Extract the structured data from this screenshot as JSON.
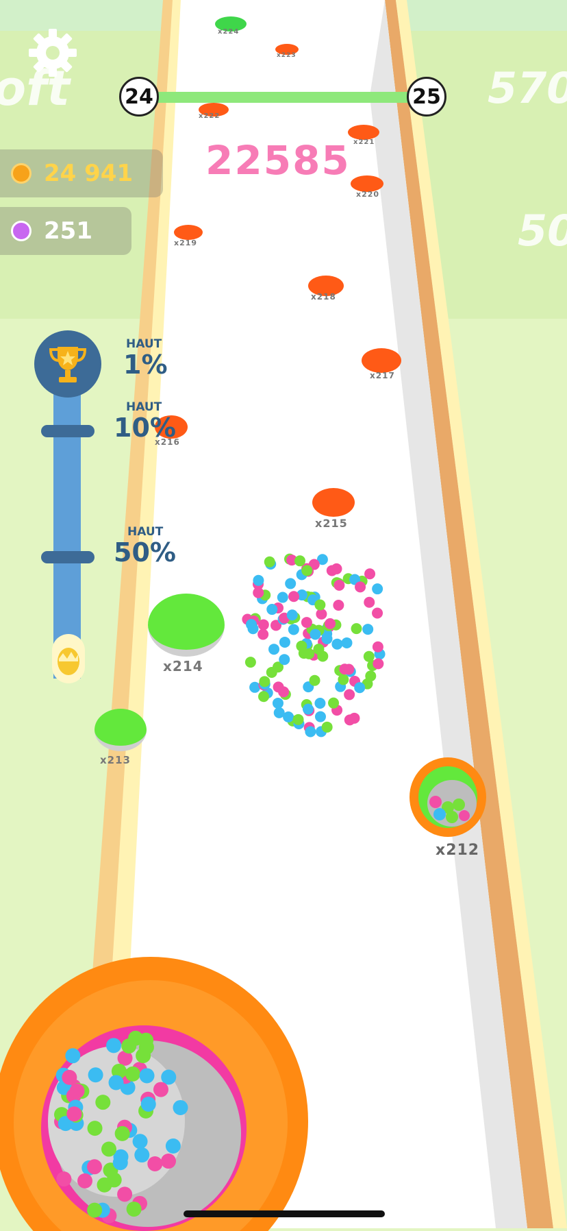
{
  "level": {
    "current": "24",
    "next": "25",
    "progress": 1.0
  },
  "score": "22585",
  "wallet": {
    "coins": "24 941",
    "gems": "251"
  },
  "ranking": {
    "items": [
      {
        "label": "HAUT",
        "pct": "1%"
      },
      {
        "label": "HAUT",
        "pct": "10%"
      },
      {
        "label": "HAUT",
        "pct": "50%"
      }
    ]
  },
  "background_words": {
    "left": "oft",
    "right": "570",
    "right2": "50"
  },
  "holes": [
    {
      "label": "x224",
      "color": "#3fd64a"
    },
    {
      "label": "x223",
      "color": "#ff5a16"
    },
    {
      "label": "x222",
      "color": "#ff5a16"
    },
    {
      "label": "x221",
      "color": "#ff5a16"
    },
    {
      "label": "x220",
      "color": "#ff5a16"
    },
    {
      "label": "x219",
      "color": "#ff5a16"
    },
    {
      "label": "x218",
      "color": "#ff5a16"
    },
    {
      "label": "x217",
      "color": "#ff5a16"
    },
    {
      "label": "x216",
      "color": "#ff5a16"
    },
    {
      "label": "x215",
      "color": "#ff5a16"
    },
    {
      "label": "x214",
      "color": "#63e83c"
    },
    {
      "label": "x213",
      "color": "#63e83c"
    },
    {
      "label": "x212",
      "color": "#63e83c"
    }
  ],
  "colors": {
    "coin": "#f7a21a",
    "gem": "#c867f0",
    "ball_pink": "#f24ea6",
    "ball_blue": "#3bbcf2",
    "ball_green": "#76e03a",
    "ring_orange": "#ff8a12"
  },
  "icons": [
    "gear-icon",
    "coin-icon",
    "gem-icon",
    "trophy-icon",
    "egg-icon"
  ]
}
